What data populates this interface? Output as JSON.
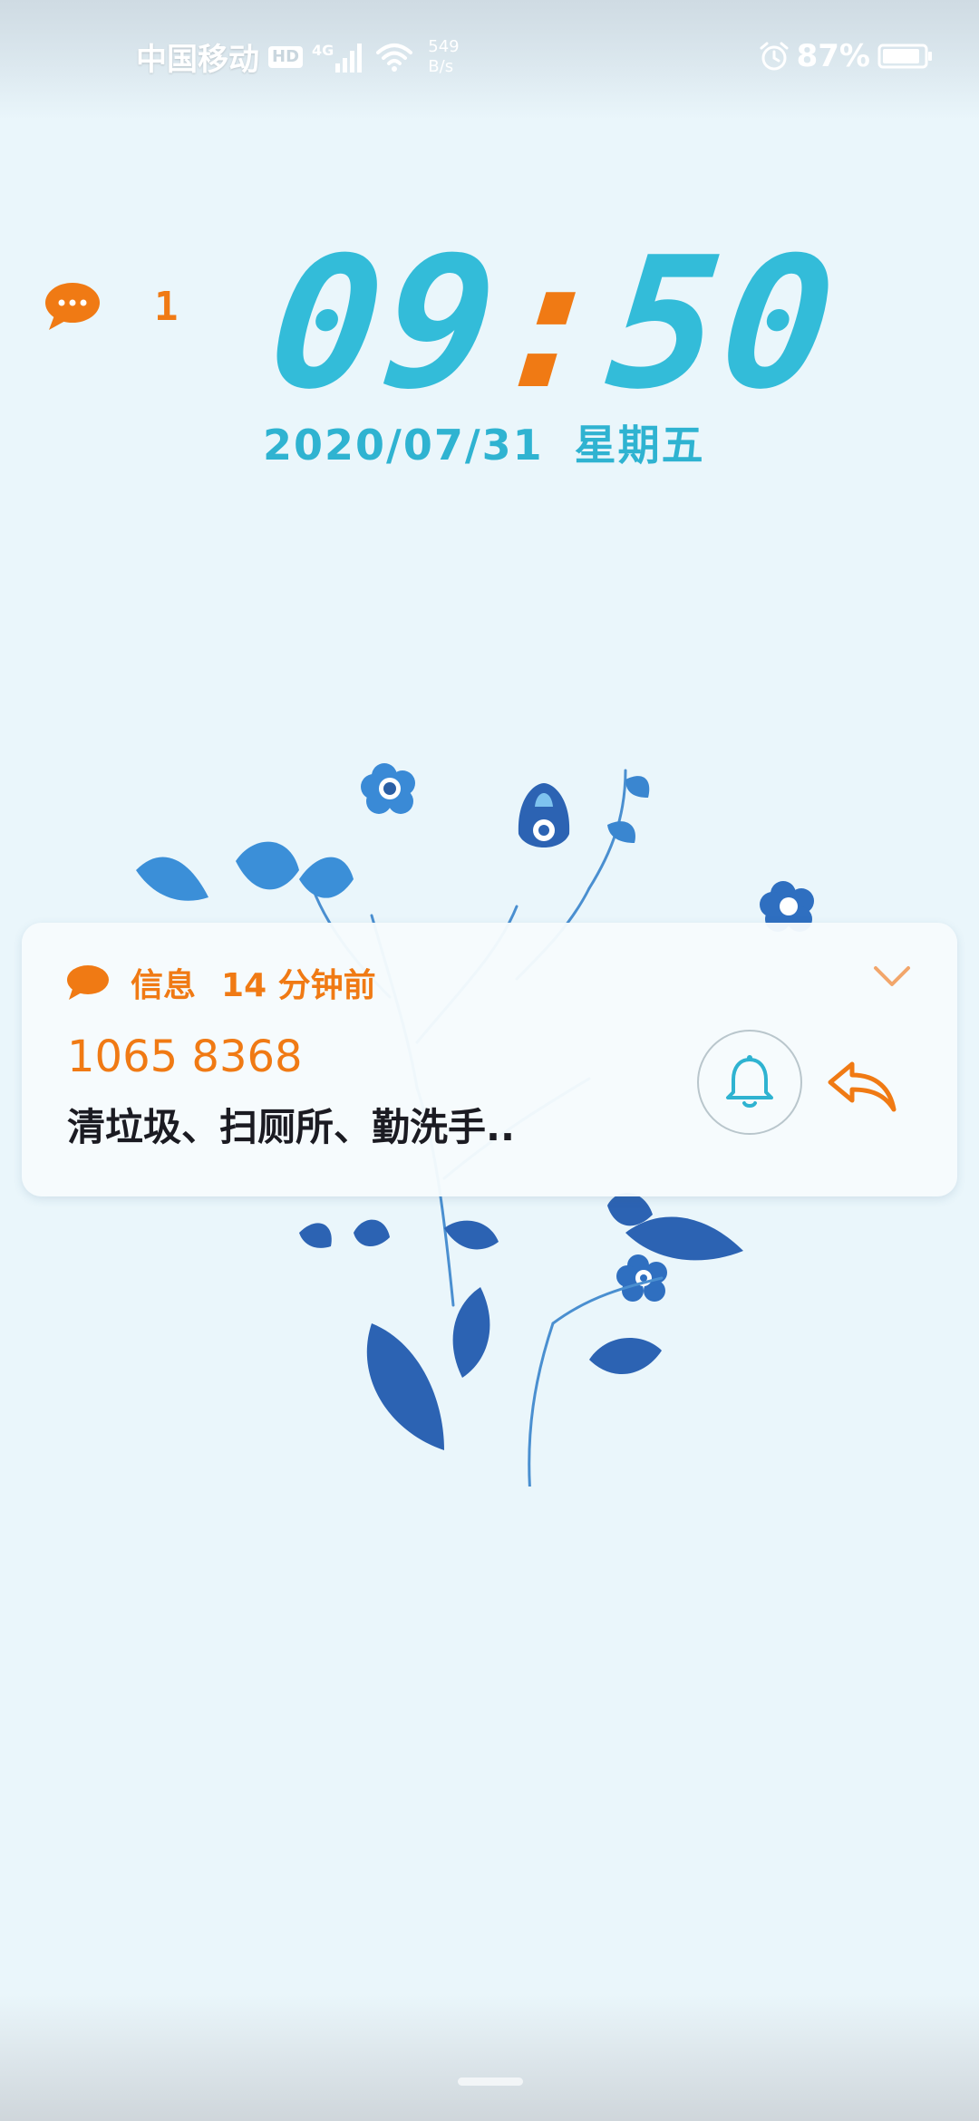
{
  "status_bar": {
    "carrier": "中国移动",
    "hd_badge": "HD",
    "network_type": "4G",
    "net_speed_value": "549",
    "net_speed_unit": "B/s",
    "battery_percent": "87%",
    "icons": [
      "signal-icon",
      "wifi-icon",
      "alarm-icon",
      "battery-icon"
    ]
  },
  "lock_screen": {
    "unread_messages_count": "1",
    "clock_hours": "09",
    "clock_separator": ":",
    "clock_minutes": "50",
    "date": "2020/07/31",
    "weekday": "星期五"
  },
  "notification": {
    "app_name": "信息",
    "time_ago": "14 分钟前",
    "sender": "1065 8368",
    "preview": "清垃圾、扫厕所、勤洗手..",
    "icons": [
      "message-bubble-icon",
      "chevron-down-icon",
      "bell-icon",
      "reply-icon"
    ]
  },
  "colors": {
    "accent_orange": "#f07a14",
    "clock_cyan": "#33bcd9",
    "background": "#eaf6fb",
    "flower_blue": "#2c6fc0"
  }
}
